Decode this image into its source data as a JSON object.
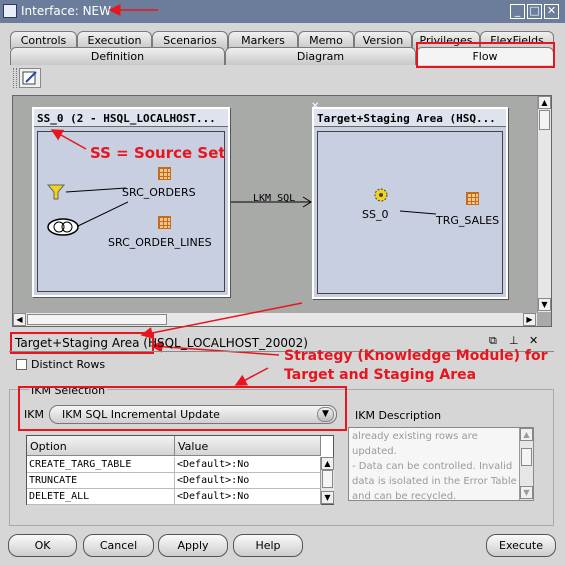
{
  "window": {
    "title": "Interface: NEW",
    "minimize": "_",
    "maximize": "□",
    "close": "✕"
  },
  "tabs_row1": [
    "Controls",
    "Execution",
    "Scenarios",
    "Markers",
    "Memo",
    "Version",
    "Privileges",
    "FlexFields"
  ],
  "tabs_row2": [
    "Definition",
    "Diagram",
    "Flow"
  ],
  "active_tab": "Flow",
  "diagram": {
    "source_set": {
      "title": "SS_0 (2 - HSQL_LOCALHOST...",
      "items": [
        "SRC_ORDERS",
        "SRC_ORDER_LINES"
      ]
    },
    "target": {
      "title": "Target+Staging Area (HSQ...",
      "source_label": "SS_0",
      "target_label": "TRG_SALES"
    },
    "flow_label": "LKM SQL"
  },
  "annotations": {
    "source_set": "SS = Source Set",
    "strategy_line1": "Strategy (Knowledge Module) for",
    "strategy_line2": "Target and Staging Area"
  },
  "properties": {
    "header": "Target+Staging Area (HSQL_LOCALHOST_20002)",
    "distinct_rows_label": "Distinct Rows",
    "distinct_rows_checked": false,
    "ikm_section_label": "IKM Selection",
    "ikm_label": "IKM",
    "ikm_value": "IKM SQL Incremental Update",
    "ikm_description_label": "IKM Description",
    "ikm_description_lines": [
      "already existing rows are",
      "updated.",
      "- Data can be controlled. Invalid",
      "data is isolated in the Error Table",
      "and can be recycled."
    ],
    "options": {
      "columns": [
        "Option",
        "Value"
      ],
      "rows": [
        [
          "CREATE_TARG_TABLE",
          "<Default>:No"
        ],
        [
          "TRUNCATE",
          "<Default>:No"
        ],
        [
          "DELETE_ALL",
          "<Default>:No"
        ]
      ]
    }
  },
  "buttons": {
    "ok": "OK",
    "cancel": "Cancel",
    "apply": "Apply",
    "help": "Help",
    "execute": "Execute"
  },
  "colors": {
    "annotation": "#e8141e",
    "titlebar": "#6b7d9b",
    "canvas_box": "#c7cfe0"
  }
}
